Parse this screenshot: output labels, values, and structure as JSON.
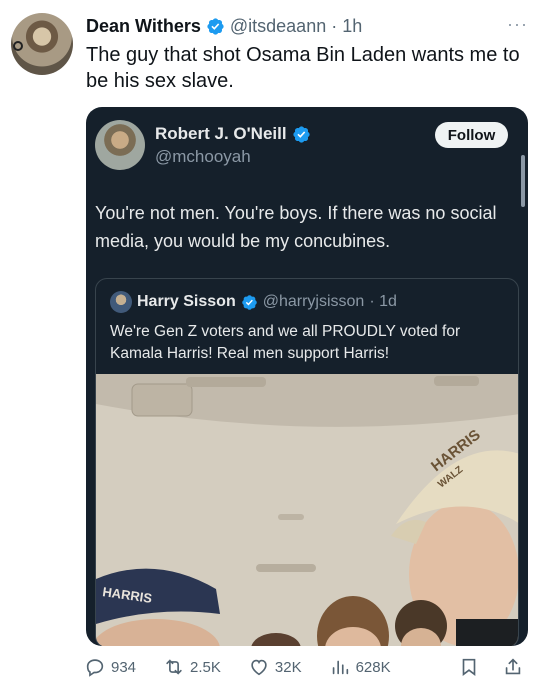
{
  "tweet": {
    "author_name": "Dean Withers",
    "author_handle": "@itsdeaann",
    "time": "· 1h",
    "more": "···",
    "text": "The guy that shot Osama Bin Laden wants me to be his sex slave."
  },
  "quoted": {
    "author_name": "Robert J. O'Neill",
    "author_handle": "@mchooyah",
    "follow_label": "Follow",
    "text": "You're not men. You're boys. If there was no social media, you would be my concubines."
  },
  "nested_quote": {
    "author_name": "Harry Sisson",
    "author_handle": "@harryjsisson",
    "time": "· 1d",
    "text": "We're Gen Z voters and we all PROUDLY voted for Kamala Harris! Real men support Harris!"
  },
  "photo": {
    "hat_text_right": "HARRIS",
    "hat_text_right_sub": "WALZ",
    "hat_text_left": "HARRIS"
  },
  "actions": {
    "replies": "934",
    "reposts": "2.5K",
    "likes": "32K",
    "views": "628K"
  },
  "colors": {
    "verified": "#1d9bf0",
    "dark_bg": "#15202b",
    "muted": "#536471"
  }
}
